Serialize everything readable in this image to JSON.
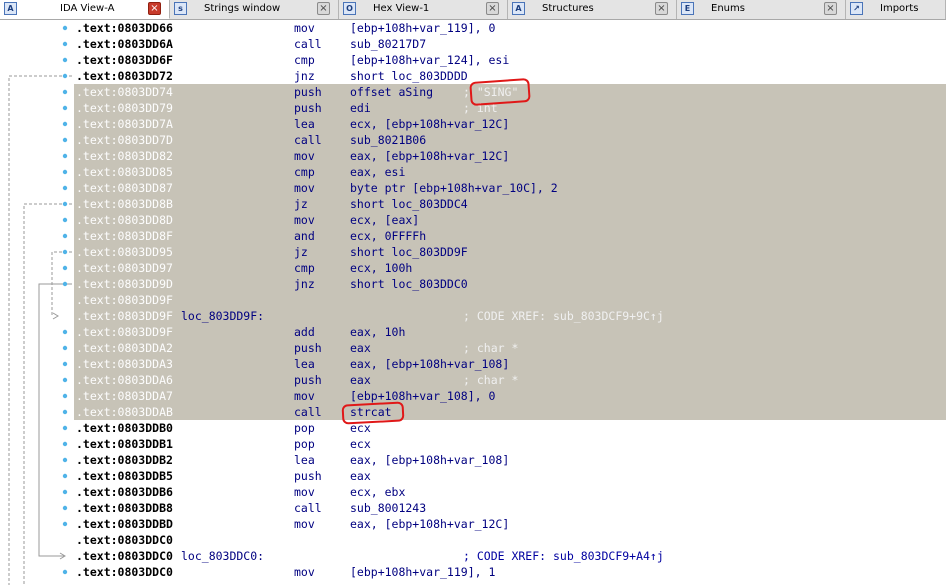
{
  "tabs": [
    {
      "label": "IDA View-A",
      "icon": "ida-view-icon",
      "glyph": "A",
      "active": true
    },
    {
      "label": "Strings window",
      "icon": "strings-icon",
      "glyph": "s",
      "active": false
    },
    {
      "label": "Hex View-1",
      "icon": "hex-view-icon",
      "glyph": "O",
      "active": false
    },
    {
      "label": "Structures",
      "icon": "structures-icon",
      "glyph": "A",
      "active": false
    },
    {
      "label": "Enums",
      "icon": "enums-icon",
      "glyph": "E",
      "active": false
    },
    {
      "label": "Imports",
      "icon": "imports-icon",
      "glyph": "↗",
      "active": false
    }
  ],
  "close_glyph": "×",
  "colors": {
    "selection_bg": "#c7c3b7",
    "selected_address_text": "#fdfdfd",
    "code_text": "#000080",
    "breakpoint_dot": "#4fb3e8",
    "annotation_circle": "#e01818",
    "flow_arrow": "#9a9a9a"
  },
  "lines": [
    {
      "addr": ".text:0803DD66",
      "label": "",
      "mnemonic": "mov",
      "operands": "[ebp+108h+var_119], 0",
      "comment": "",
      "selected": false
    },
    {
      "addr": ".text:0803DD6A",
      "label": "",
      "mnemonic": "call",
      "operands": "sub_80217D7",
      "comment": "",
      "selected": false
    },
    {
      "addr": ".text:0803DD6F",
      "label": "",
      "mnemonic": "cmp",
      "operands": "[ebp+108h+var_124], esi",
      "comment": "",
      "selected": false
    },
    {
      "addr": ".text:0803DD72",
      "label": "",
      "mnemonic": "jnz",
      "operands": "short loc_803DDDD",
      "comment": "",
      "selected": false
    },
    {
      "addr": ".text:0803DD74",
      "label": "",
      "mnemonic": "push",
      "operands": "offset aSing",
      "comment": "; \"SING\"",
      "selected": true
    },
    {
      "addr": ".text:0803DD79",
      "label": "",
      "mnemonic": "push",
      "operands": "edi",
      "comment": "; int",
      "selected": true
    },
    {
      "addr": ".text:0803DD7A",
      "label": "",
      "mnemonic": "lea",
      "operands": "ecx, [ebp+108h+var_12C]",
      "comment": "",
      "selected": true
    },
    {
      "addr": ".text:0803DD7D",
      "label": "",
      "mnemonic": "call",
      "operands": "sub_8021B06",
      "comment": "",
      "selected": true
    },
    {
      "addr": ".text:0803DD82",
      "label": "",
      "mnemonic": "mov",
      "operands": "eax, [ebp+108h+var_12C]",
      "comment": "",
      "selected": true
    },
    {
      "addr": ".text:0803DD85",
      "label": "",
      "mnemonic": "cmp",
      "operands": "eax, esi",
      "comment": "",
      "selected": true
    },
    {
      "addr": ".text:0803DD87",
      "label": "",
      "mnemonic": "mov",
      "operands": "byte ptr [ebp+108h+var_10C], 2",
      "comment": "",
      "selected": true
    },
    {
      "addr": ".text:0803DD8B",
      "label": "",
      "mnemonic": "jz",
      "operands": "short loc_803DDC4",
      "comment": "",
      "selected": true
    },
    {
      "addr": ".text:0803DD8D",
      "label": "",
      "mnemonic": "mov",
      "operands": "ecx, [eax]",
      "comment": "",
      "selected": true
    },
    {
      "addr": ".text:0803DD8F",
      "label": "",
      "mnemonic": "and",
      "operands": "ecx, 0FFFFh",
      "comment": "",
      "selected": true
    },
    {
      "addr": ".text:0803DD95",
      "label": "",
      "mnemonic": "jz",
      "operands": "short loc_803DD9F",
      "comment": "",
      "selected": true
    },
    {
      "addr": ".text:0803DD97",
      "label": "",
      "mnemonic": "cmp",
      "operands": "ecx, 100h",
      "comment": "",
      "selected": true
    },
    {
      "addr": ".text:0803DD9D",
      "label": "",
      "mnemonic": "jnz",
      "operands": "short loc_803DDC0",
      "comment": "",
      "selected": true
    },
    {
      "addr": ".text:0803DD9F",
      "label": "",
      "mnemonic": "",
      "operands": "",
      "comment": "",
      "selected": true
    },
    {
      "addr": ".text:0803DD9F",
      "label": "loc_803DD9F:",
      "mnemonic": "",
      "operands": "",
      "comment": "; CODE XREF: sub_803DCF9+9C↑j",
      "selected": true
    },
    {
      "addr": ".text:0803DD9F",
      "label": "",
      "mnemonic": "add",
      "operands": "eax, 10h",
      "comment": "",
      "selected": true
    },
    {
      "addr": ".text:0803DDA2",
      "label": "",
      "mnemonic": "push",
      "operands": "eax",
      "comment": "; char *",
      "selected": true
    },
    {
      "addr": ".text:0803DDA3",
      "label": "",
      "mnemonic": "lea",
      "operands": "eax, [ebp+108h+var_108]",
      "comment": "",
      "selected": true
    },
    {
      "addr": ".text:0803DDA6",
      "label": "",
      "mnemonic": "push",
      "operands": "eax",
      "comment": "; char *",
      "selected": true
    },
    {
      "addr": ".text:0803DDA7",
      "label": "",
      "mnemonic": "mov",
      "operands": "[ebp+108h+var_108], 0",
      "comment": "",
      "selected": true
    },
    {
      "addr": ".text:0803DDAB",
      "label": "",
      "mnemonic": "call",
      "operands": "strcat",
      "comment": "",
      "selected": true
    },
    {
      "addr": ".text:0803DDB0",
      "label": "",
      "mnemonic": "pop",
      "operands": "ecx",
      "comment": "",
      "selected": false
    },
    {
      "addr": ".text:0803DDB1",
      "label": "",
      "mnemonic": "pop",
      "operands": "ecx",
      "comment": "",
      "selected": false
    },
    {
      "addr": ".text:0803DDB2",
      "label": "",
      "mnemonic": "lea",
      "operands": "eax, [ebp+108h+var_108]",
      "comment": "",
      "selected": false
    },
    {
      "addr": ".text:0803DDB5",
      "label": "",
      "mnemonic": "push",
      "operands": "eax",
      "comment": "",
      "selected": false
    },
    {
      "addr": ".text:0803DDB6",
      "label": "",
      "mnemonic": "mov",
      "operands": "ecx, ebx",
      "comment": "",
      "selected": false
    },
    {
      "addr": ".text:0803DDB8",
      "label": "",
      "mnemonic": "call",
      "operands": "sub_8001243",
      "comment": "",
      "selected": false
    },
    {
      "addr": ".text:0803DDBD",
      "label": "",
      "mnemonic": "mov",
      "operands": "eax, [ebp+108h+var_12C]",
      "comment": "",
      "selected": false
    },
    {
      "addr": ".text:0803DDC0",
      "label": "",
      "mnemonic": "",
      "operands": "",
      "comment": "",
      "selected": false
    },
    {
      "addr": ".text:0803DDC0",
      "label": "loc_803DDC0:",
      "mnemonic": "",
      "operands": "",
      "comment": "; CODE XREF: sub_803DCF9+A4↑j",
      "selected": false
    },
    {
      "addr": ".text:0803DDC0",
      "label": "",
      "mnemonic": "mov",
      "operands": "[ebp+108h+var_119], 1",
      "comment": "",
      "selected": false
    }
  ]
}
